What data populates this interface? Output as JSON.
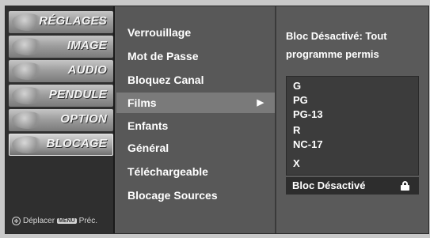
{
  "categories": [
    {
      "label": "RÉGLAGES",
      "active": false
    },
    {
      "label": "IMAGE",
      "active": false
    },
    {
      "label": "AUDIO",
      "active": false
    },
    {
      "label": "PENDULE",
      "active": false
    },
    {
      "label": "OPTION",
      "active": false
    },
    {
      "label": "BLOCAGE",
      "active": true
    }
  ],
  "help": {
    "move_icon": "dpad-icon",
    "move_label": "Déplacer",
    "menu_key": "MENU",
    "back_label": "Préc."
  },
  "menu": {
    "items": [
      {
        "label": "Verrouillage"
      },
      {
        "label": "Mot de Passe"
      },
      {
        "label": "Bloquez Canal"
      },
      {
        "label": "Films",
        "selected": true,
        "arrow": "▶"
      },
      {
        "label": "Enfants"
      },
      {
        "label": "Général"
      },
      {
        "label": "Téléchargeable"
      },
      {
        "label": "Blocage Sources"
      }
    ]
  },
  "right_panel": {
    "info_line1": "Bloc Désactivé: Tout",
    "info_line2": "programme permis",
    "ratings": [
      "G",
      "PG",
      "PG-13",
      "R",
      "NC-17",
      "X"
    ],
    "status_label": "Bloc Désactivé",
    "status_icon": "unlock-icon"
  },
  "colors": {
    "panel_bg": "#585858",
    "selected_bg": "#7a7a7a",
    "text": "#ffffff"
  }
}
